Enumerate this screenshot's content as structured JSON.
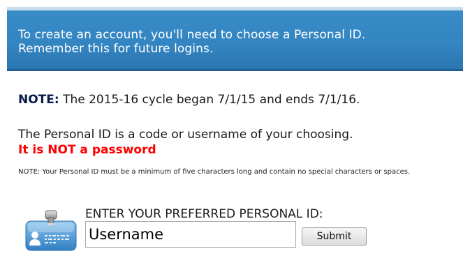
{
  "banner": {
    "line1": "To create an account, you'll need to choose a Personal ID.",
    "line2": "Remember this for future logins."
  },
  "cycle_note": {
    "label": "NOTE:",
    "text": " The 2015-16 cycle began 7/1/15 and ends 7/1/16."
  },
  "personal_id_info": {
    "description": "The Personal ID is a code or username of your choosing.",
    "warning": "It is NOT a password",
    "requirements": "NOTE: Your Personal ID must be a minimum of five characters long and contain no special characters or spaces."
  },
  "form": {
    "label": "ENTER YOUR PREFERRED PERSONAL ID:",
    "input_value": "Username",
    "submit_label": "Submit"
  },
  "colors": {
    "banner_blue": "#3385c1",
    "warning_red": "#ff0000",
    "note_navy": "#0a1b4a"
  },
  "icons": {
    "id_card": "id-card-icon"
  }
}
